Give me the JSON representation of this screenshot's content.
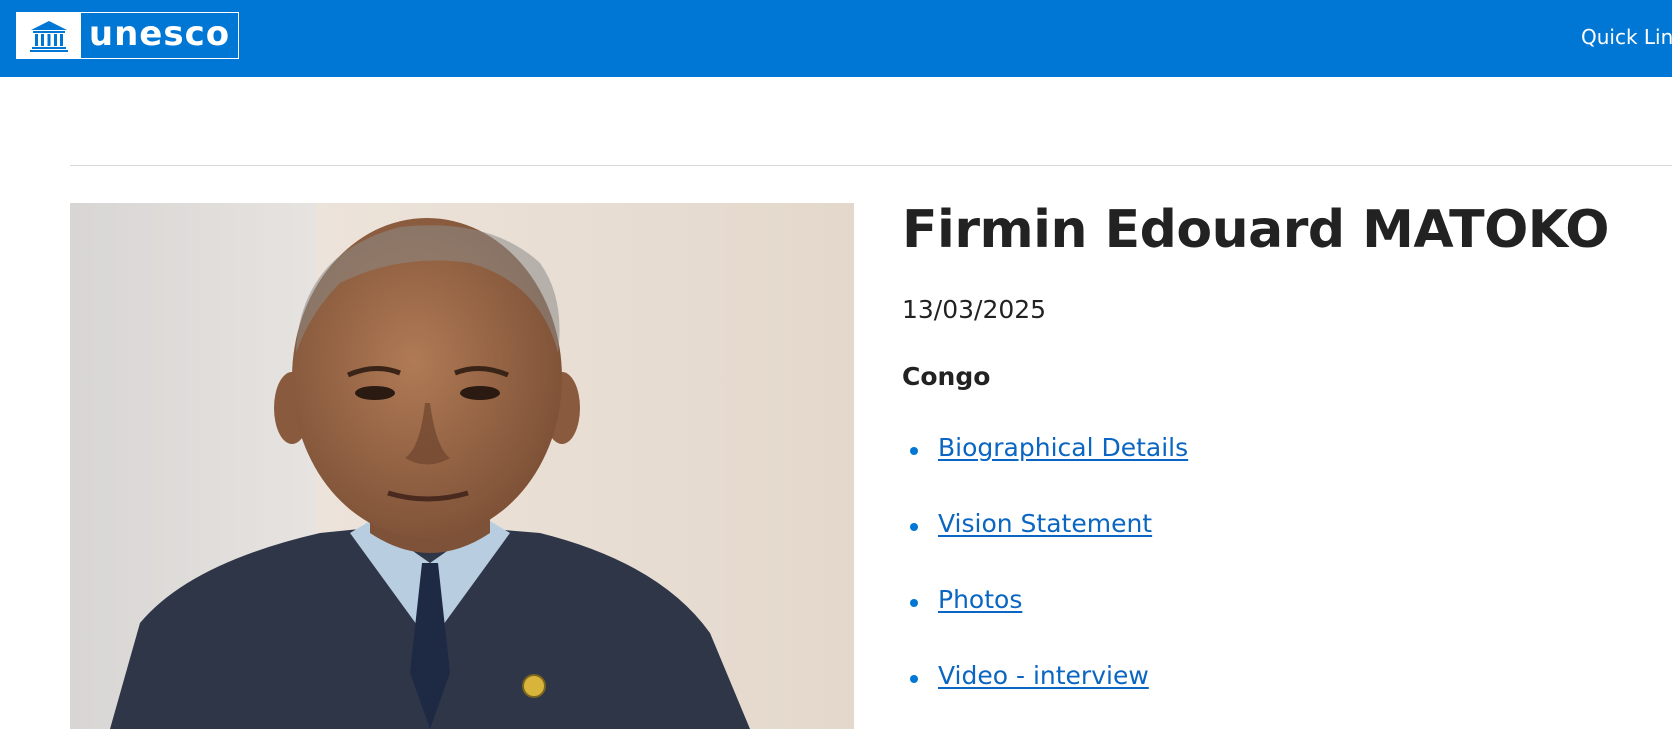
{
  "header": {
    "logo_text": "unesco",
    "quick_links_label": "Quick Lin",
    "brand_color": "#0077d4",
    "logo_icon": "temple-emblem-icon"
  },
  "profile": {
    "name": "Firmin Edouard MATOKO",
    "date": "13/03/2025",
    "country": "Congo",
    "links": [
      {
        "label": "Biographical Details"
      },
      {
        "label": "Vision Statement"
      },
      {
        "label": "Photos"
      },
      {
        "label": "Video - interview"
      }
    ],
    "link_color": "#0a66c2"
  }
}
